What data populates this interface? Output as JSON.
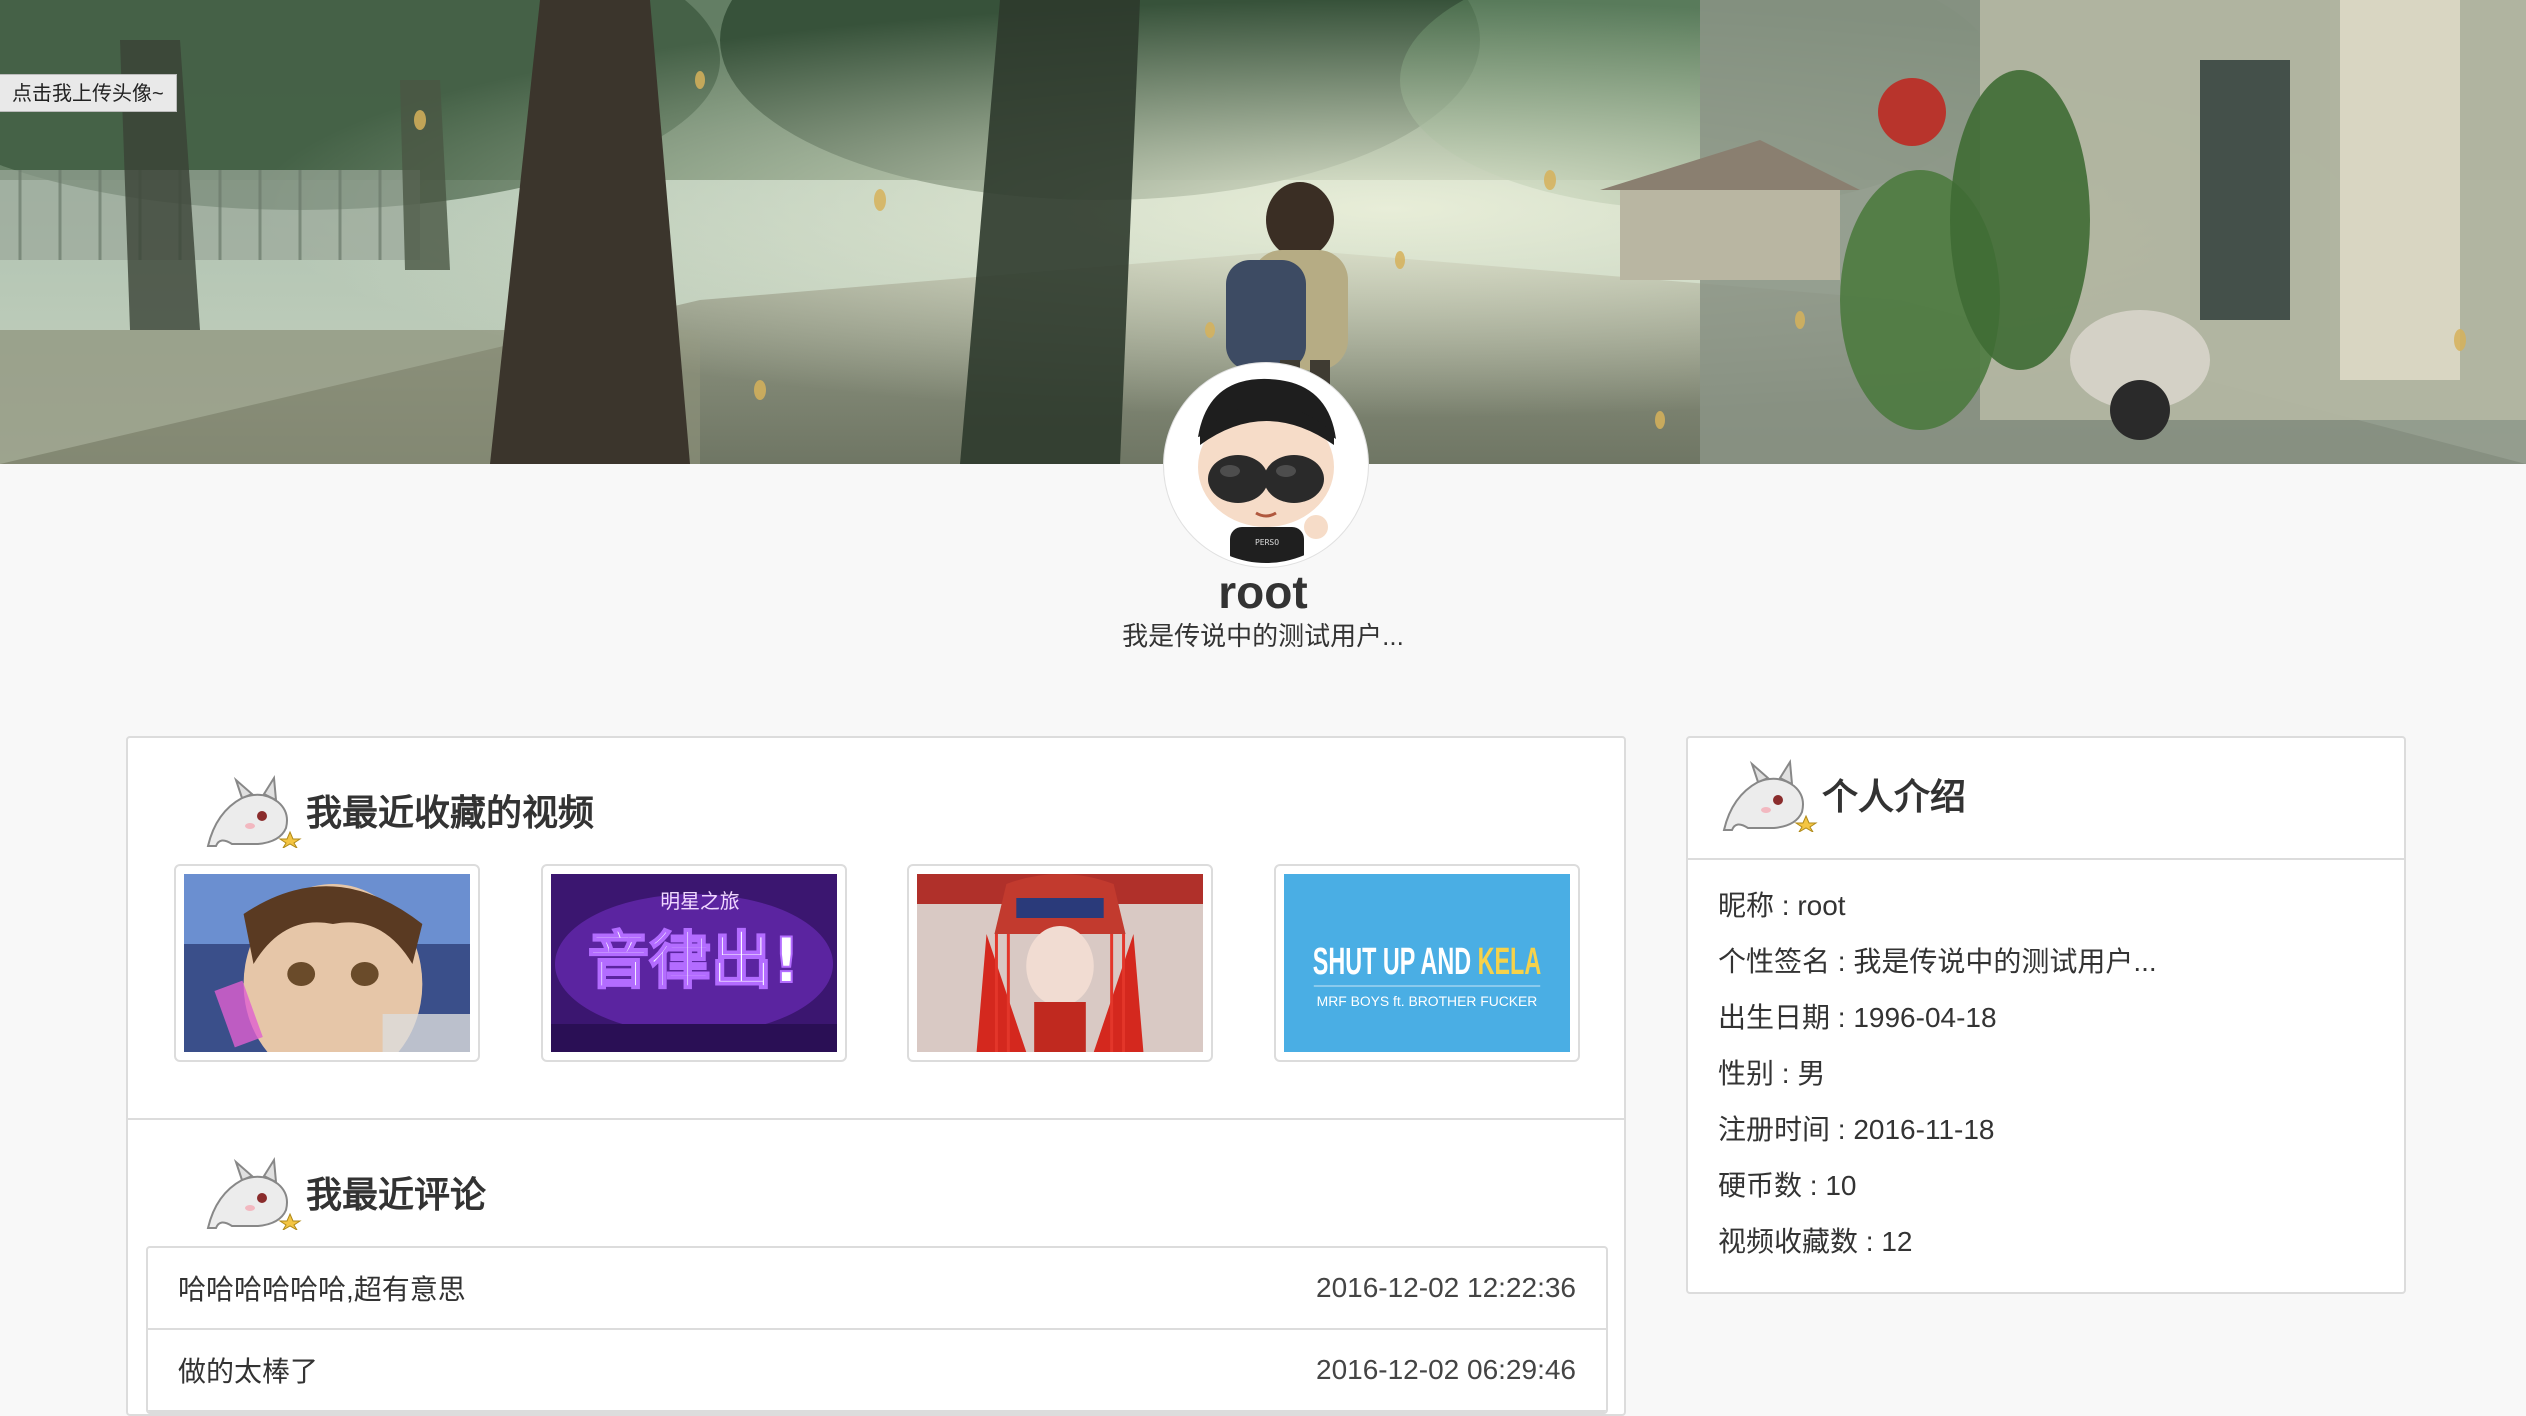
{
  "banner": {
    "upload_tip": "点击我上传头像~"
  },
  "user": {
    "username": "root",
    "signature": "我是传说中的测试用户..."
  },
  "favorites": {
    "title": "我最近收藏的视频",
    "videos": [
      {
        "thumbnail": "anime-boy-thumbnail"
      },
      {
        "thumbnail": "music-show-thumbnail",
        "text": "明星之旅 音律出!"
      },
      {
        "thumbnail": "opera-costume-thumbnail"
      },
      {
        "thumbnail": "shut-up-and-kela-thumbnail",
        "text": "SHUT UP AND KELA",
        "subtext": "MRF BOYS ft. BROTHER FUCKER"
      }
    ]
  },
  "comments": {
    "title": "我最近评论",
    "items": [
      {
        "text": "哈哈哈哈哈哈,超有意思",
        "date": "2016-12-02 12:22:36"
      },
      {
        "text": "做的太棒了",
        "date": "2016-12-02 06:29:46"
      }
    ]
  },
  "intro": {
    "title": "个人介绍",
    "fields": [
      {
        "label": "昵称",
        "value": "root",
        "line": "昵称 : root"
      },
      {
        "label": "个性签名",
        "value": "我是传说中的测试用户...",
        "line": "个性签名 : 我是传说中的测试用户..."
      },
      {
        "label": "出生日期",
        "value": "1996-04-18",
        "line": "出生日期 : 1996-04-18"
      },
      {
        "label": "性别",
        "value": "男",
        "line": "性别 : 男"
      },
      {
        "label": "注册时间",
        "value": "2016-11-18",
        "line": "注册时间 : 2016-11-18"
      },
      {
        "label": "硬币数",
        "value": "10",
        "line": "硬币数 : 10"
      },
      {
        "label": "视频收藏数",
        "value": "12",
        "line": "视频收藏数 : 12"
      }
    ]
  },
  "colors": {
    "page_bg": "#f8f8f8",
    "panel_border": "#dcdcdc",
    "text": "#333333",
    "kela_blue": "#4aaee4",
    "kela_yellow": "#f6d24a"
  }
}
